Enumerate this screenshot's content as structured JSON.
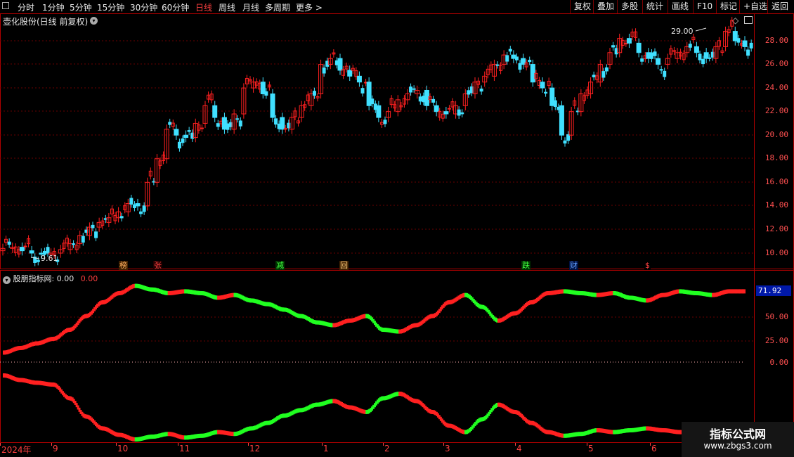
{
  "toolbar": {
    "periods": [
      "分时",
      "1分钟",
      "5分钟",
      "15分钟",
      "30分钟",
      "60分钟",
      "日线",
      "周线",
      "月线",
      "多周期",
      "更多 >"
    ],
    "active_period": "日线",
    "right_buttons": [
      "复权",
      "叠加",
      "多股",
      "统计",
      "画线",
      "F10",
      "标记",
      "+自选",
      "返回"
    ]
  },
  "stock": {
    "title": "壶化股份(日线 前复权)"
  },
  "price_axis": [
    "28.00",
    "26.00",
    "24.00",
    "22.00",
    "20.00",
    "18.00",
    "16.00",
    "14.00",
    "12.00",
    "10.00"
  ],
  "annotations": {
    "high": "29.00",
    "low": "9.61"
  },
  "markers": [
    {
      "text": "榜",
      "color": "#ffb060",
      "bg": "#402000"
    },
    {
      "text": "张",
      "color": "#ff4040",
      "bg": "#200000"
    },
    {
      "text": "减",
      "color": "#40ff40",
      "bg": "#003000"
    },
    {
      "text": "回",
      "color": "#ffd080",
      "bg": "#402000"
    },
    {
      "text": "跌",
      "color": "#40ff40",
      "bg": "#003000"
    },
    {
      "text": "财",
      "color": "#60a0ff",
      "bg": "#001040"
    },
    {
      "text": "$",
      "color": "#ff4040",
      "bg": "#000000"
    }
  ],
  "indicator": {
    "name": "股朋指标网",
    "value1": ": 0.00",
    "value2": "0.00",
    "axis": [
      "50.00",
      "25.00",
      "0.00"
    ],
    "current": "71.92"
  },
  "dates": [
    "2024年",
    "9",
    "10",
    "11",
    "12",
    "1",
    "2",
    "3",
    "4",
    "5",
    "6"
  ],
  "colors": {
    "up": "#ff2020",
    "down": "#20ff20",
    "grid": "#7a0000",
    "axis": "#ff5050"
  },
  "watermark": {
    "title": "指标公式网",
    "url": "www.zbgs3.com"
  },
  "chart_data": {
    "type": "candlestick",
    "price_range": [
      9.0,
      29.5
    ],
    "closes": [
      10.4,
      10.5,
      10.2,
      10.0,
      9.9,
      10.0,
      10.3,
      10.8,
      11.5,
      12.2,
      12.6,
      13.0,
      13.5,
      14.2,
      14.0,
      16.0,
      18.0,
      20.5,
      20.0,
      19.8,
      21.0,
      22.5,
      21.5,
      20.5,
      21.8,
      24.0,
      24.5,
      23.5,
      21.5,
      20.5,
      21.5,
      22.5,
      23.5,
      26.0,
      26.5,
      25.5,
      25.0,
      24.5,
      22.5,
      21.5,
      22.0,
      23.0,
      23.5,
      23.8,
      22.5,
      22.0,
      21.8,
      22.5,
      23.5,
      24.5,
      25.0,
      26.0,
      26.8,
      26.5,
      26.0,
      24.5,
      24.0,
      22.5,
      20.0,
      22.0,
      23.5,
      24.5,
      26.0,
      27.0,
      28.2,
      27.8,
      27.0,
      26.5,
      26.0,
      26.5,
      27.0,
      27.5,
      27.0,
      26.5,
      27.5,
      28.8,
      28.0,
      27.5
    ]
  },
  "indicator_data": {
    "top": [
      5,
      10,
      15,
      20,
      30,
      45,
      60,
      70,
      78,
      74,
      70,
      72,
      70,
      65,
      68,
      62,
      58,
      52,
      45,
      38,
      35,
      40,
      45,
      30,
      28,
      35,
      45,
      60,
      68,
      55,
      40,
      48,
      60,
      70,
      72,
      70,
      68,
      70,
      65,
      62,
      68,
      72,
      70,
      68,
      72,
      72
    ],
    "bottom": [
      10,
      15,
      18,
      20,
      35,
      55,
      68,
      75,
      80,
      77,
      74,
      78,
      76,
      72,
      74,
      68,
      62,
      54,
      48,
      42,
      38,
      45,
      50,
      35,
      30,
      38,
      50,
      65,
      72,
      58,
      42,
      50,
      62,
      72,
      76,
      74,
      70,
      72,
      70,
      68,
      70,
      72,
      74,
      70,
      70,
      72
    ]
  }
}
